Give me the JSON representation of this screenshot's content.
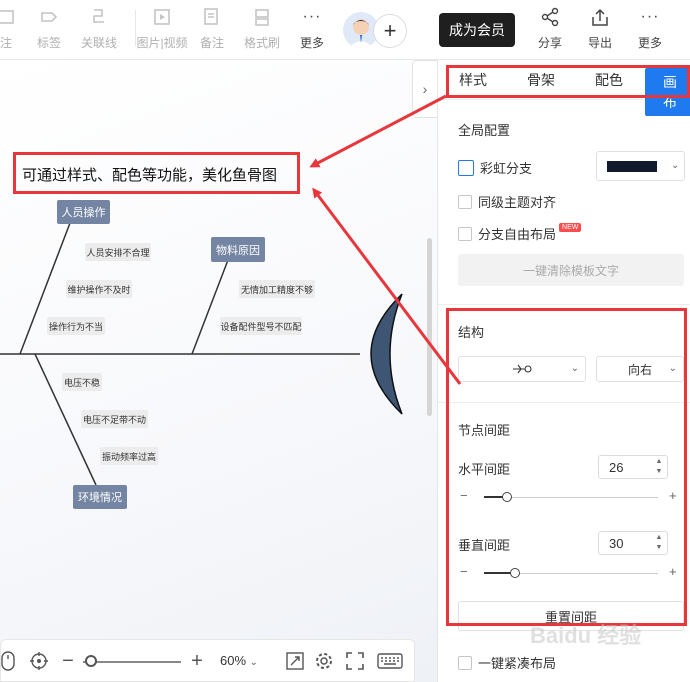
{
  "toolbar": {
    "items": [
      {
        "label": "注",
        "icon": "note-icon"
      },
      {
        "label": "标签",
        "icon": "tag-icon"
      },
      {
        "label": "关联线",
        "icon": "relation-line-icon"
      },
      {
        "label": "图片|视频",
        "icon": "image-video-icon"
      },
      {
        "label": "备注",
        "icon": "memo-icon"
      },
      {
        "label": "格式刷",
        "icon": "format-brush-icon"
      },
      {
        "label": "更多",
        "icon": "more-icon"
      }
    ],
    "vip_label": "成为会员",
    "right_items": [
      {
        "label": "分享",
        "icon": "share-icon"
      },
      {
        "label": "导出",
        "icon": "export-icon"
      },
      {
        "label": "更多",
        "icon": "more-icon"
      }
    ]
  },
  "canvas": {
    "annotation": "可通过样式、配色等功能，美化鱼骨图",
    "topics": [
      "人员操作",
      "物料原因",
      "环境情况"
    ],
    "subs": [
      "人员安排不合理",
      "维护操作不及时",
      "操作行为不当",
      "无情加工精度不够",
      "设备配件型号不匹配",
      "电压不稳",
      "电压不足带不动",
      "振动频率过高"
    ],
    "zoom": "60%"
  },
  "panel": {
    "tabs": [
      "样式",
      "骨架",
      "配色",
      "画布"
    ],
    "global_title": "全局配置",
    "rainbow_label": "彩虹分支",
    "align_label": "同级主题对齐",
    "free_layout_label": "分支自由布局",
    "new_badge": "NEW",
    "clear_btn": "一键清除模板文字",
    "structure_title": "结构",
    "direction": "向右",
    "spacing_title": "节点间距",
    "h_label": "水平间距",
    "h_value": "26",
    "v_label": "垂直间距",
    "v_value": "30",
    "reset_btn": "重置间距",
    "compact_label": "一键紧凑布局"
  },
  "watermark": "Baidu 经验",
  "colors": {
    "accent": "#1f7af0",
    "annotation": "#e8373c",
    "topic": "#7485a3",
    "head": "#3e5574"
  }
}
